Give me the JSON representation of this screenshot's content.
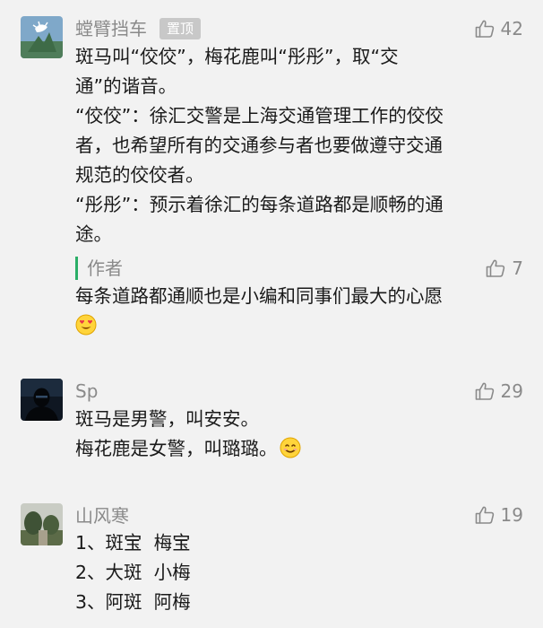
{
  "comments": [
    {
      "username": "螳臂挡车",
      "pin_badge": "置顶",
      "likes": "42",
      "lines": [
        "斑马叫“佼佼”，梅花鹿叫“彤彤”，取“交",
        "通”的谐音。",
        "“佼佼”：徐汇交警是上海交通管理工作的佼佼",
        "者，也希望所有的交通参与者也要做遵守交通",
        "规范的佼佼者。",
        "“彤彤”：预示着徐汇的每条道路都是顺畅的通",
        "途。"
      ],
      "reply": {
        "author_label": "作者",
        "likes": "7",
        "text": "每条道路都通顺也是小编和同事们最大的心愿",
        "emoji": "heart-eyes-emoji"
      }
    },
    {
      "username": "Sp",
      "likes": "29",
      "line1": "斑马是男警，叫安安。",
      "line2": "梅花鹿是女警，叫璐璐。",
      "emoji": "smile-emoji"
    },
    {
      "username": "山风寒",
      "likes": "19",
      "lines": [
        "1、斑宝  梅宝",
        "2、大斑  小梅",
        "3、阿斑  阿梅"
      ]
    }
  ],
  "colors": {
    "background": "#f2f2f2",
    "secondary_text": "#8a8a8a",
    "author_bar": "#2aae67"
  }
}
